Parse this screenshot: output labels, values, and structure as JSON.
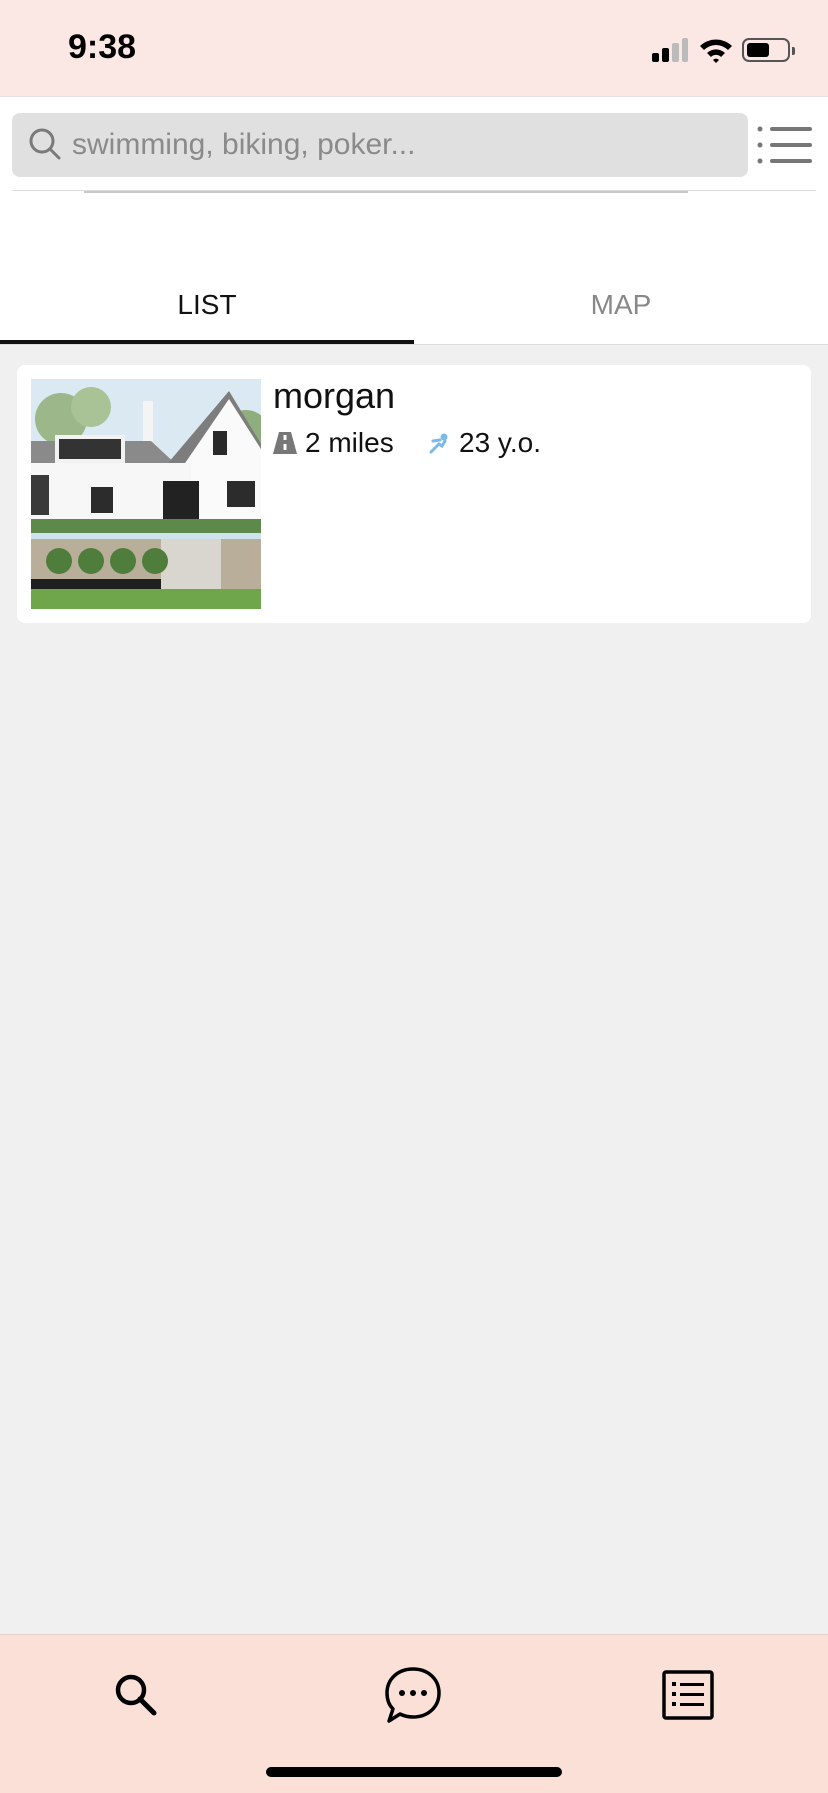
{
  "status_bar": {
    "time": "9:38"
  },
  "search": {
    "placeholder": "swimming, biking, poker...",
    "value": ""
  },
  "tabs": [
    {
      "label": "LIST",
      "active": true
    },
    {
      "label": "MAP",
      "active": false
    }
  ],
  "results": [
    {
      "name": "morgan",
      "distance": "2 miles",
      "age": "23 y.o."
    }
  ],
  "bottom_nav": [
    "search-icon",
    "chat-icon",
    "list-icon"
  ],
  "colors": {
    "status_bar_bg": "#fbe8e4",
    "bottom_bar_bg": "#fbe0d7",
    "accent": "#111111",
    "page_bg": "#f0f0f0"
  }
}
